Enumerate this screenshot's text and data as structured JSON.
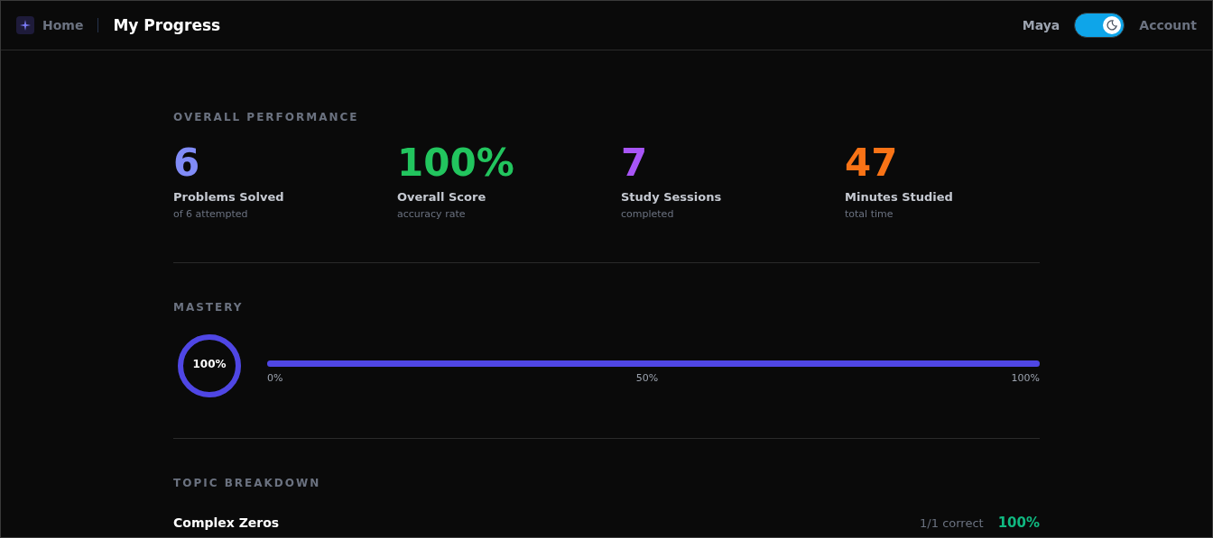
{
  "header": {
    "home": "Home",
    "title": "My Progress",
    "user": "Maya",
    "dark_mode": {
      "on": true
    },
    "account": "Account"
  },
  "overall": {
    "heading": "OVERALL PERFORMANCE",
    "stats": [
      {
        "value": "6",
        "label": "Problems Solved",
        "sub": "of 6 attempted",
        "color": "#818cf8"
      },
      {
        "value": "100%",
        "label": "Overall Score",
        "sub": "accuracy rate",
        "color": "#22c55e"
      },
      {
        "value": "7",
        "label": "Study Sessions",
        "sub": "completed",
        "color": "#a855f7"
      },
      {
        "value": "47",
        "label": "Minutes Studied",
        "sub": "total time",
        "color": "#f97316"
      }
    ]
  },
  "mastery": {
    "heading": "MASTERY",
    "ring_label": "100%",
    "scale": [
      "0%",
      "50%",
      "100%"
    ]
  },
  "topics": {
    "heading": "TOPIC BREAKDOWN",
    "rows": [
      {
        "name": "Complex Zeros",
        "count": "1/1 correct",
        "score": "100%"
      }
    ]
  }
}
